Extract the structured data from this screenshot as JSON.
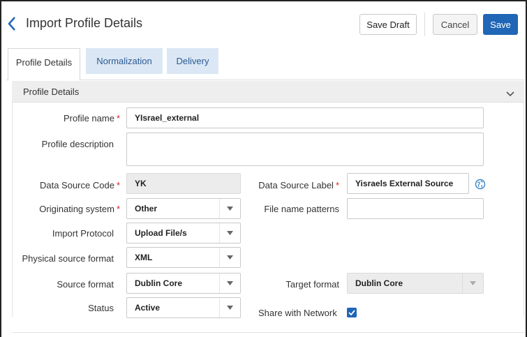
{
  "header": {
    "title": "Import Profile Details",
    "save_draft_label": "Save Draft",
    "cancel_label": "Cancel",
    "save_label": "Save"
  },
  "tabs": [
    {
      "label": "Profile Details",
      "active": true
    },
    {
      "label": "Normalization",
      "active": false
    },
    {
      "label": "Delivery",
      "active": false
    }
  ],
  "section": {
    "title": "Profile Details"
  },
  "form": {
    "profile_name": {
      "label": "Profile name",
      "value": "YIsrael_external",
      "required": true
    },
    "profile_description": {
      "label": "Profile description",
      "value": ""
    },
    "data_source_code": {
      "label": "Data Source Code",
      "value": "YK",
      "required": true
    },
    "data_source_label": {
      "label": "Data Source Label",
      "value": "Yisraels External Source",
      "required": true
    },
    "originating_system": {
      "label": "Originating system",
      "value": "Other",
      "required": true
    },
    "file_name_patterns": {
      "label": "File name patterns",
      "value": ""
    },
    "import_protocol": {
      "label": "Import Protocol",
      "value": "Upload File/s"
    },
    "physical_source_format": {
      "label": "Physical source format",
      "value": "XML"
    },
    "source_format": {
      "label": "Source format",
      "value": "Dublin Core"
    },
    "target_format": {
      "label": "Target format",
      "value": "Dublin Core"
    },
    "status": {
      "label": "Status",
      "value": "Active"
    },
    "share_with_network": {
      "label": "Share with Network",
      "checked": true
    }
  },
  "required_marker": "*",
  "colors": {
    "primary": "#1f66b6",
    "tab_inactive_bg": "#dbe7f4",
    "required": "#dd2222"
  },
  "icons": {
    "back": "chevron-left-icon",
    "collapse": "chevron-down-icon",
    "language": "globe-icon",
    "dropdown": "caret-down-icon",
    "check": "check-icon"
  }
}
